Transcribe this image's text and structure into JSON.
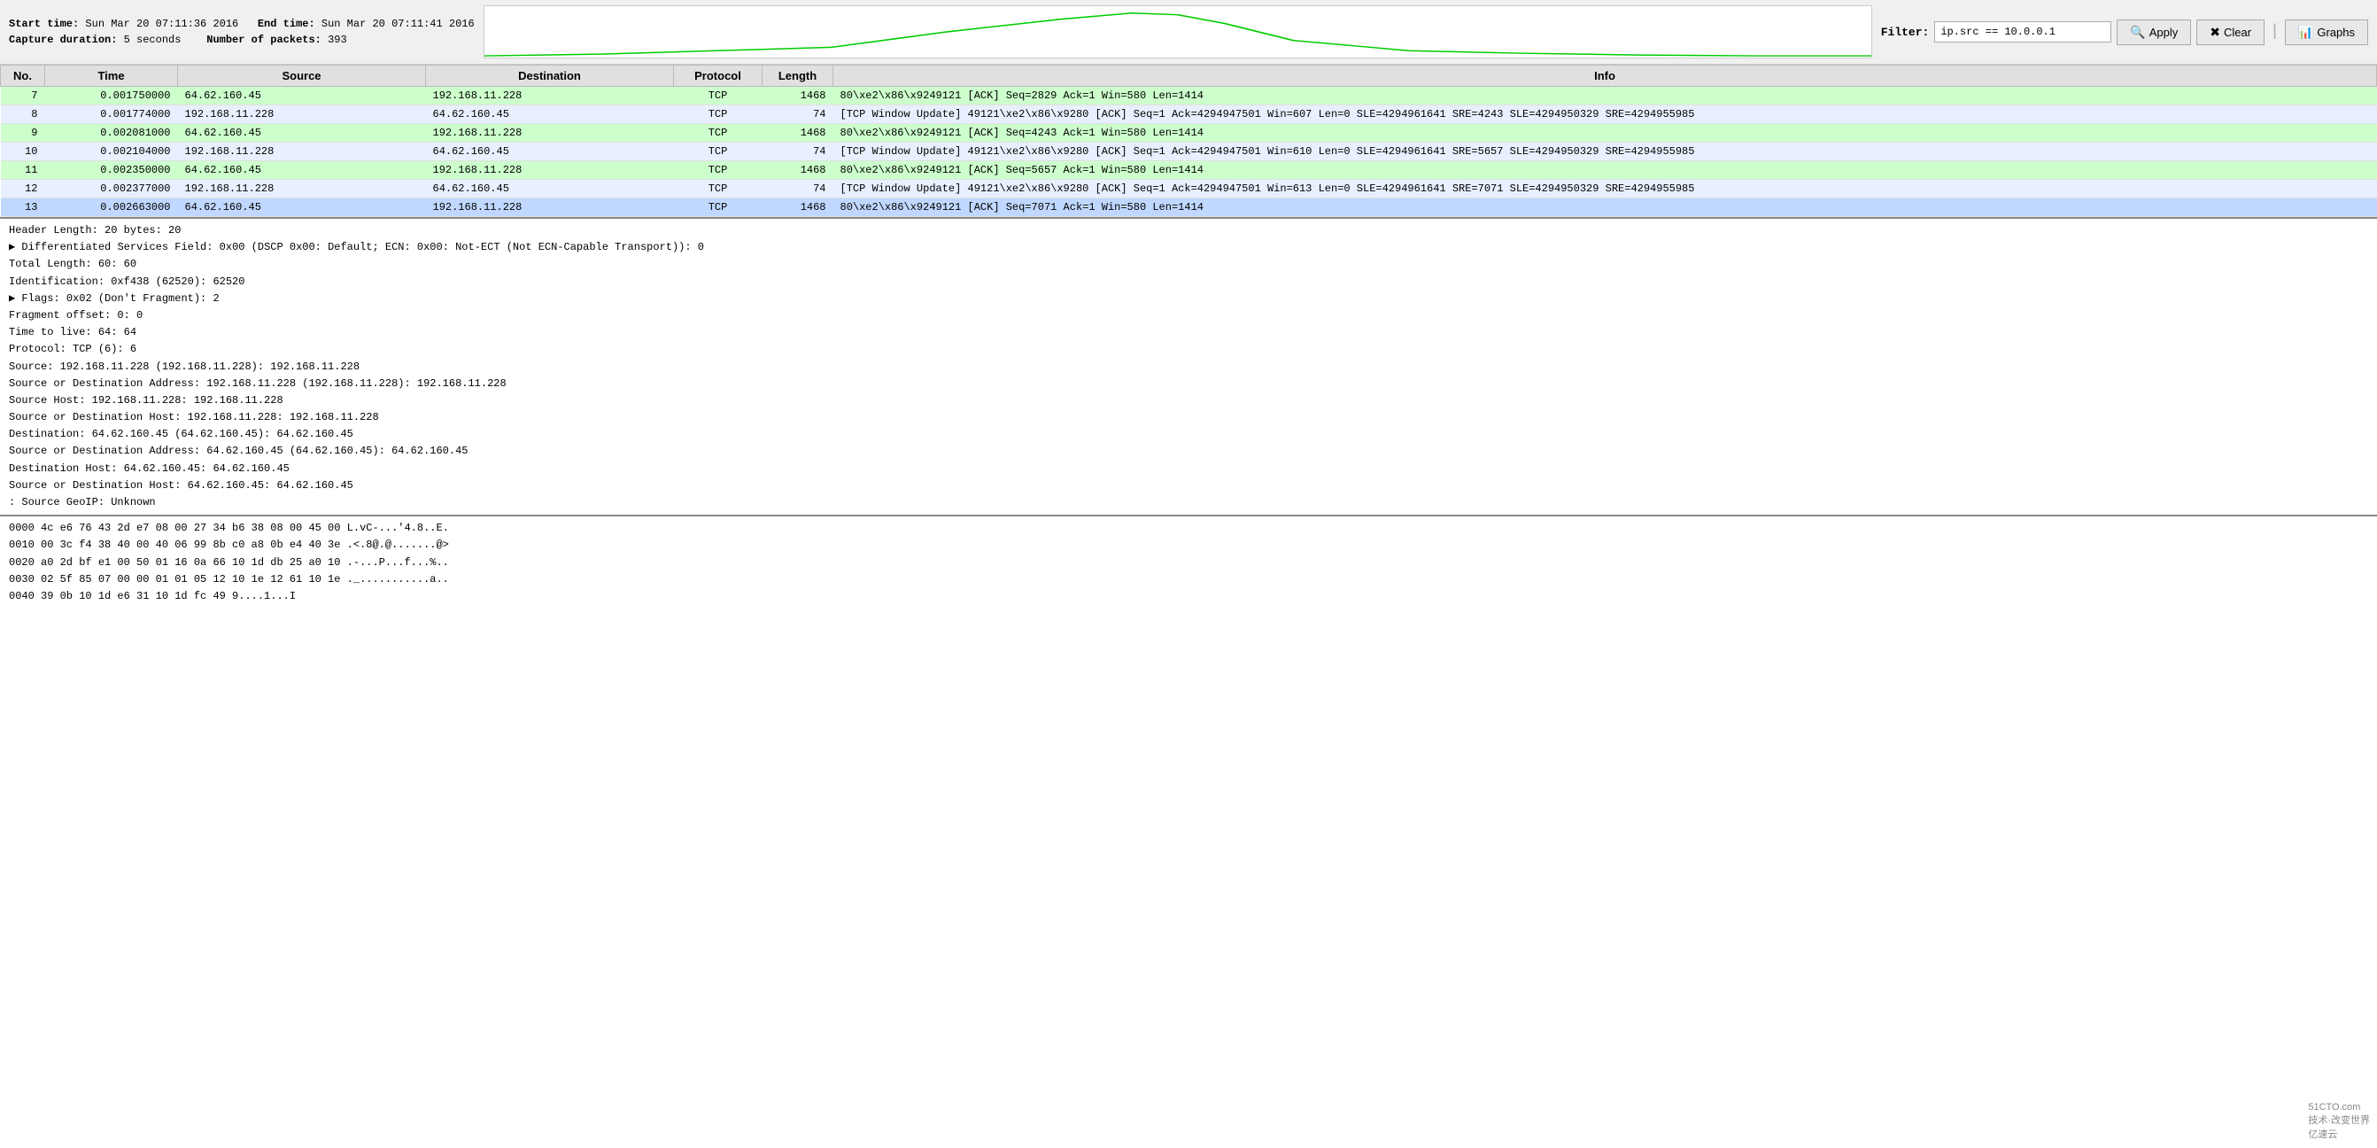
{
  "header": {
    "start_label": "Start time:",
    "start_value": "Sun Mar 20 07:11:36 2016",
    "end_label": "End time:",
    "end_value": "Sun Mar 20 07:11:41 2016",
    "capture_label": "Capture duration:",
    "capture_value": "5 seconds",
    "packets_label": "Number of packets:",
    "packets_value": "393"
  },
  "filter": {
    "label": "Filter:",
    "value": "ip.src == 10.0.0.1"
  },
  "buttons": {
    "apply": "Apply",
    "clear": "Clear",
    "graphs": "Graphs"
  },
  "table": {
    "columns": [
      "No.",
      "Time",
      "Source",
      "Destination",
      "Protocol",
      "Length",
      "Info"
    ],
    "rows": [
      {
        "no": "7",
        "time": "0.001750000",
        "source": "64.62.160.45",
        "dest": "192.168.11.228",
        "proto": "TCP",
        "len": "1468",
        "info": "80\\xe2\\x86\\x9249121 [ACK] Seq=2829 Ack=1 Win=580 Len=1414",
        "style": "highlight-green"
      },
      {
        "no": "8",
        "time": "0.001774000",
        "source": "192.168.11.228",
        "dest": "64.62.160.45",
        "proto": "TCP",
        "len": "74",
        "info": "[TCP Window Update] 49121\\xe2\\x86\\x9280 [ACK] Seq=1 Ack=4294947501 Win=607 Len=0 SLE=4294961641 SRE=4243 SLE=4294950329 SRE=4294955985",
        "style": "normal"
      },
      {
        "no": "9",
        "time": "0.002081000",
        "source": "64.62.160.45",
        "dest": "192.168.11.228",
        "proto": "TCP",
        "len": "1468",
        "info": "80\\xe2\\x86\\x9249121 [ACK] Seq=4243 Ack=1 Win=580 Len=1414",
        "style": "highlight-green"
      },
      {
        "no": "10",
        "time": "0.002104000",
        "source": "192.168.11.228",
        "dest": "64.62.160.45",
        "proto": "TCP",
        "len": "74",
        "info": "[TCP Window Update] 49121\\xe2\\x86\\x9280 [ACK] Seq=1 Ack=4294947501 Win=610 Len=0 SLE=4294961641 SRE=5657 SLE=4294950329 SRE=4294955985",
        "style": "normal"
      },
      {
        "no": "11",
        "time": "0.002350000",
        "source": "64.62.160.45",
        "dest": "192.168.11.228",
        "proto": "TCP",
        "len": "1468",
        "info": "80\\xe2\\x86\\x9249121 [ACK] Seq=5657 Ack=1 Win=580 Len=1414",
        "style": "highlight-green"
      },
      {
        "no": "12",
        "time": "0.002377000",
        "source": "192.168.11.228",
        "dest": "64.62.160.45",
        "proto": "TCP",
        "len": "74",
        "info": "[TCP Window Update] 49121\\xe2\\x86\\x9280 [ACK] Seq=1 Ack=4294947501 Win=613 Len=0 SLE=4294961641 SRE=7071 SLE=4294950329 SRE=4294955985",
        "style": "normal"
      },
      {
        "no": "13",
        "time": "0.002663000",
        "source": "64.62.160.45",
        "dest": "192.168.11.228",
        "proto": "TCP",
        "len": "1468",
        "info": "80\\xe2\\x86\\x9249121 [ACK] Seq=7071 Ack=1 Win=580 Len=1414",
        "style": "selected"
      }
    ]
  },
  "detail": {
    "lines": [
      "Header Length: 20 bytes: 20",
      "▶ Differentiated Services Field: 0x00 (DSCP 0x00: Default; ECN: 0x00: Not-ECT (Not ECN-Capable Transport)): 0",
      "Total Length: 60: 60",
      "Identification: 0xf438 (62520): 62520",
      "▶ Flags: 0x02 (Don't Fragment): 2",
      "Fragment offset: 0: 0",
      "Time to live: 64: 64",
      "Protocol: TCP (6): 6",
      "Source: 192.168.11.228 (192.168.11.228): 192.168.11.228",
      "Source or Destination Address: 192.168.11.228 (192.168.11.228): 192.168.11.228",
      "Source Host: 192.168.11.228: 192.168.11.228",
      "Source or Destination Host: 192.168.11.228: 192.168.11.228",
      "Destination: 64.62.160.45 (64.62.160.45): 64.62.160.45",
      "Source or Destination Address: 64.62.160.45 (64.62.160.45): 64.62.160.45",
      "Destination Host: 64.62.160.45: 64.62.160.45",
      "Source or Destination Host: 64.62.160.45: 64.62.160.45",
      ": Source GeoIP: Unknown"
    ]
  },
  "hex": {
    "lines": [
      "0000   4c e6 76 43 2d e7 08 00 27 34 b6 38 08 00 45 00    L.vC-...'4.8..E.",
      "0010   00 3c f4 38 40 00 40 06 99 8b c0 a8 0b e4 40 3e    .<.8@.@.......@>",
      "0020   a0 2d bf e1 00 50 01 16 0a 66 10 1d db 25 a0 10    .-...P...f...%..",
      "0030   02 5f 85 07 00 00 01 01 05 12 10 1e 12 61 10 1e    ._...........a..",
      "0040   39 0b 10 1d e6 31 10 1d fc 49                       9....1...I"
    ]
  },
  "watermark": {
    "line1": "51CTO.com",
    "line2": "技术·改变世界",
    "line3": "亿速云"
  }
}
